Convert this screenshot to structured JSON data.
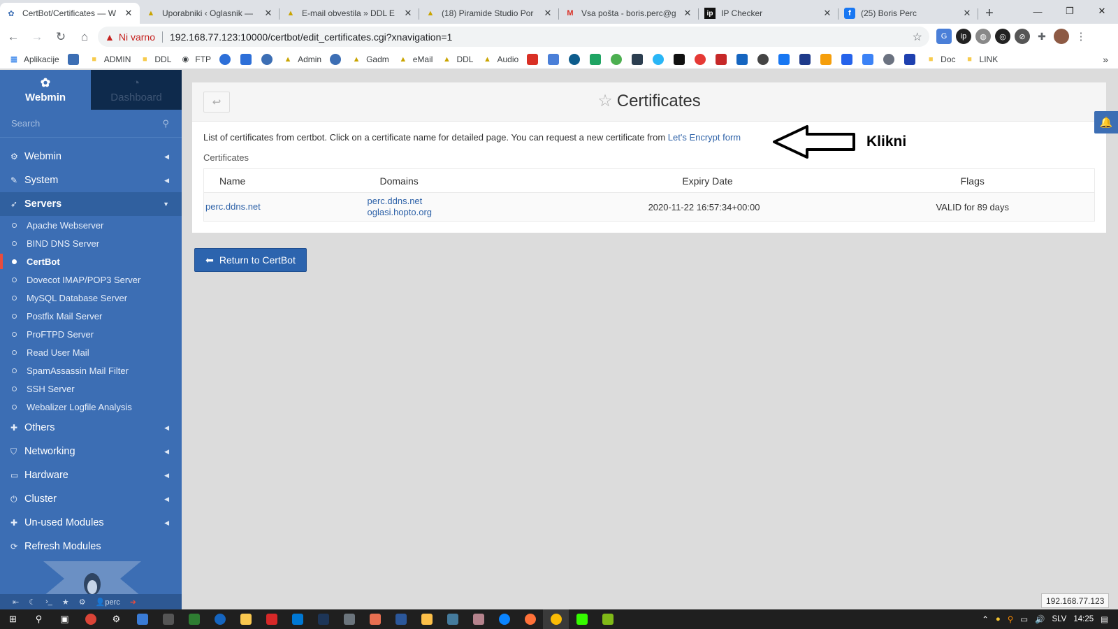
{
  "browser": {
    "tabs": [
      {
        "title": "CertBot/Certificates — W",
        "icon": "webmin-icon",
        "active": true
      },
      {
        "title": "Uporabniki ‹ Oglasnik —",
        "icon": "ddl-icon"
      },
      {
        "title": "E-mail obvestila » DDL E",
        "icon": "ddl-icon"
      },
      {
        "title": "(18) Piramide Studio Por",
        "icon": "ddl-icon"
      },
      {
        "title": "Vsa pošta - boris.perc@g",
        "icon": "gmail-icon"
      },
      {
        "title": "IP Checker",
        "icon": "ip-icon"
      },
      {
        "title": "(25) Boris Perc",
        "icon": "facebook-icon"
      }
    ],
    "tab_close": "✕",
    "new_tab": "+",
    "window": {
      "minimize": "—",
      "restore": "❐",
      "close": "✕"
    },
    "address": {
      "security_label": "Ni varno",
      "url": "192.168.77.123:10000/certbot/edit_certificates.cgi?xnavigation=1"
    },
    "bookmarks": [
      "Aplikacije",
      "ADMIN",
      "DDL",
      "FTP",
      "Admin",
      "Gadm",
      "eMail",
      "DDL",
      "Audio",
      "Doc",
      "LINK"
    ],
    "bookmarks_more": "»"
  },
  "sidebar": {
    "tab_webmin": "Webmin",
    "tab_dashboard": "Dashboard",
    "search_placeholder": "Search",
    "menu": [
      {
        "label": "Webmin",
        "icon": "gear-icon"
      },
      {
        "label": "System",
        "icon": "wrench-icon"
      },
      {
        "label": "Servers",
        "icon": "rocket-icon",
        "open": true
      },
      {
        "label": "Others",
        "icon": "puzzle-icon"
      },
      {
        "label": "Networking",
        "icon": "shield-icon"
      },
      {
        "label": "Hardware",
        "icon": "drive-icon"
      },
      {
        "label": "Cluster",
        "icon": "power-icon"
      },
      {
        "label": "Un-used Modules",
        "icon": "puzzle-icon"
      },
      {
        "label": "Refresh Modules",
        "icon": "refresh-icon"
      }
    ],
    "servers_items": [
      "Apache Webserver",
      "BIND DNS Server",
      "CertBot",
      "Dovecot IMAP/POP3 Server",
      "MySQL Database Server",
      "Postfix Mail Server",
      "ProFTPD Server",
      "Read User Mail",
      "SpamAssassin Mail Filter",
      "SSH Server",
      "Webalizer Logfile Analysis"
    ],
    "active_item": "CertBot",
    "user": "perc"
  },
  "page": {
    "title": "Certificates",
    "description": "List of certificates from certbot. Click on a certificate name for detailed page. You can request a new certificate from ",
    "link_text": "Let's Encrypt form",
    "annotation": "Klikni",
    "section_label": "Certificates",
    "table": {
      "headers": [
        "Name",
        "Domains",
        "Expiry Date",
        "Flags"
      ],
      "rows": [
        {
          "name": "perc.ddns.net",
          "domains": [
            "perc.ddns.net",
            "oglasi.hopto.org"
          ],
          "expiry": "2020-11-22 16:57:34+00:00",
          "flags": "VALID for 89 days"
        }
      ]
    },
    "return_button": "Return to CertBot"
  },
  "status_tooltip": "192.168.77.123",
  "taskbar": {
    "lang": "SLV",
    "time": "14:25"
  },
  "colors": {
    "sidebar": "#3c6eb4",
    "accent_link": "#2e62a8",
    "active_marker": "#e84c3d"
  }
}
